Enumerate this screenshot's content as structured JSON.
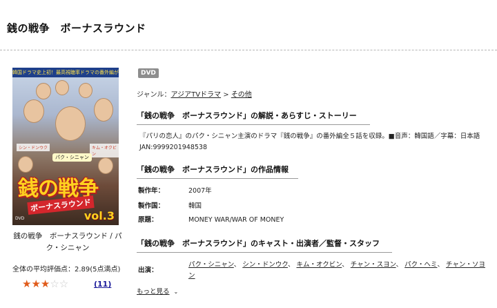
{
  "page": {
    "title": "銭の戦争　ボーナスラウンド"
  },
  "cover": {
    "banner": "韓国ドラマ史上初！最高視聴率ドラマの番外編が登場！",
    "title_art": "銭の戦争",
    "subtitle_art": "ボーナスラウンド",
    "vol": "vol.3",
    "name_tag": "パク・シニャン",
    "left_tag": "シン・ドンウク",
    "right_tag": "キム・オクビン",
    "dvd_mark": "DVD",
    "caption": "銭の戦争　ボーナスラウンド / パク・シニャン"
  },
  "rating": {
    "avg_label": "全体の平均評価点：2.89(5点満点)",
    "stars_on": "★★★",
    "stars_off": "☆☆",
    "review_count": "(11)",
    "value": 2.89,
    "max": 5
  },
  "product": {
    "badge": "DVD",
    "genre_label": "ジャンル：",
    "genre_1": "アジアTVドラマ",
    "genre_sep": " > ",
    "genre_2": "その他"
  },
  "sections": {
    "synopsis_heading": "「銭の戦争　ボーナスラウンド」の解説・あらすじ・ストーリー",
    "synopsis": "『パリの恋人』のパク・シニャン主演のドラマ『銭の戦争』の番外編全５話を収録。■音声：韓国語／字幕：日本語 JAN:9999201948538",
    "info_heading": "「銭の戦争　ボーナスラウンド」の作品情報",
    "cast_heading": "「銭の戦争　ボーナスラウンド」のキャスト・出演者／監督・スタッフ"
  },
  "info": [
    {
      "key": "製作年：",
      "value": "2007年"
    },
    {
      "key": "製作国：",
      "value": "韓国"
    },
    {
      "key": "原題：",
      "value": "MONEY WAR/WAR OF MONEY"
    }
  ],
  "cast": {
    "label": "出演：",
    "names": [
      "パク・シニャン",
      "シン・ドンウク",
      "キム・オクビン",
      "チャン・スヨン",
      "パク・ヘミ",
      "チャン・ソヨン"
    ],
    "more": "もっと見る"
  }
}
